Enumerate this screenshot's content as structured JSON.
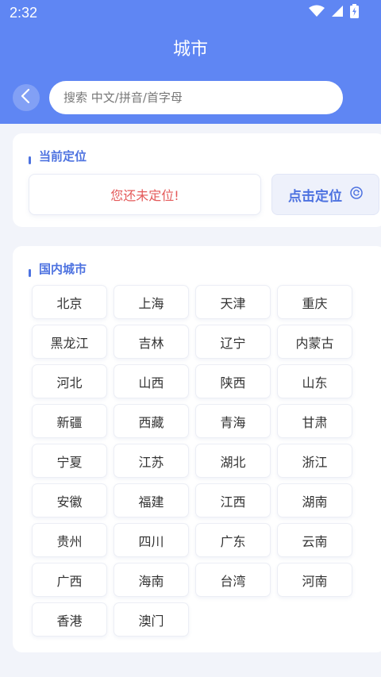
{
  "status_bar": {
    "time": "2:32",
    "icons": [
      "wifi-icon",
      "signal-icon",
      "battery-charging-icon"
    ]
  },
  "header": {
    "title": "城市",
    "back_icon": "chevron-left-icon",
    "search_placeholder": "搜索 中文/拼音/首字母",
    "background_color": "#5f86f3"
  },
  "current_location": {
    "section_title": "当前定位",
    "status_text": "您还未定位!",
    "locate_button_label": "点击定位",
    "locate_icon": "refresh-circle-icon"
  },
  "domestic_cities": {
    "section_title": "国内城市",
    "cities": [
      "北京",
      "上海",
      "天津",
      "重庆",
      "黑龙江",
      "吉林",
      "辽宁",
      "内蒙古",
      "河北",
      "山西",
      "陕西",
      "山东",
      "新疆",
      "西藏",
      "青海",
      "甘肃",
      "宁夏",
      "江苏",
      "湖北",
      "浙江",
      "安徽",
      "福建",
      "江西",
      "湖南",
      "贵州",
      "四川",
      "广东",
      "云南",
      "广西",
      "海南",
      "台湾",
      "河南",
      "香港",
      "澳门"
    ]
  },
  "colors": {
    "accent": "#4d72e0",
    "warning_text": "#e45a5a"
  }
}
